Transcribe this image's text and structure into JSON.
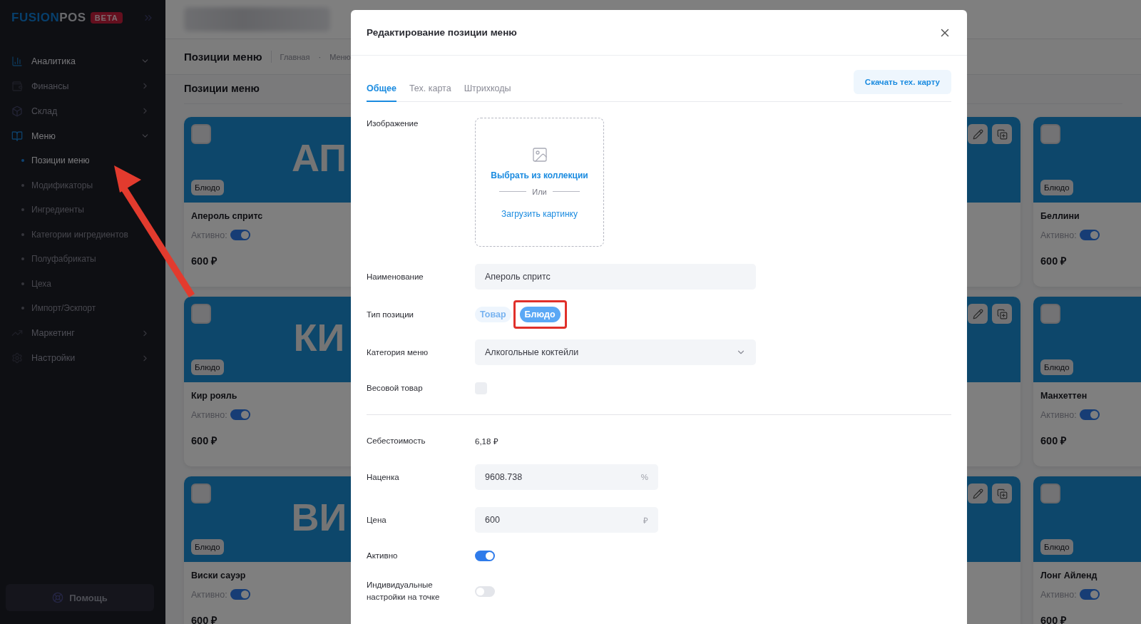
{
  "sidebar": {
    "logo": {
      "part_1": "FUSION",
      "part_2": "POS",
      "badge": "BETA"
    },
    "items": [
      {
        "kind": "analytics",
        "label": "Аналитика",
        "expanded": true
      },
      {
        "kind": "finance",
        "label": "Финансы",
        "expanded": false
      },
      {
        "kind": "warehouse",
        "label": "Склад",
        "expanded": false
      },
      {
        "kind": "menu",
        "label": "Меню",
        "expanded": true,
        "children": [
          {
            "label": "Позиции меню",
            "selected": true
          },
          {
            "label": "Модификаторы",
            "selected": false
          },
          {
            "label": "Ингредиенты",
            "selected": false
          },
          {
            "label": "Категории ингредиентов",
            "selected": false
          },
          {
            "label": "Полуфабрикаты",
            "selected": false
          },
          {
            "label": "Цеха",
            "selected": false
          },
          {
            "label": "Импорт/Эскпорт",
            "selected": false
          }
        ]
      },
      {
        "kind": "marketing",
        "label": "Маркетинг",
        "expanded": false
      },
      {
        "kind": "settings",
        "label": "Настройки",
        "expanded": false
      }
    ],
    "help": "Помощь"
  },
  "header": {
    "page_title": "Позиции меню",
    "breadcrumbs": [
      "Главная",
      "Меню"
    ],
    "breadcrumb_separator": "·",
    "section_title": "Позиции меню"
  },
  "card_rows": [
    {
      "cards": [
        {
          "kind": "full",
          "checked": false,
          "initials": "АП",
          "type": "Блюдо",
          "name": "Апероль спритс",
          "active_label": "Активно:",
          "active": true,
          "price": "600 ₽"
        },
        {
          "kind": "actions"
        },
        {
          "kind": "full",
          "checked": false,
          "type": "Блюдо",
          "name": "Беллини",
          "active_label": "Активно:",
          "active": true,
          "price": "600 ₽"
        }
      ]
    },
    {
      "cards": [
        {
          "kind": "full",
          "checked": false,
          "initials": "КИ",
          "type": "Блюдо",
          "name": "Кир рояль",
          "active_label": "Активно:",
          "active": true,
          "price": "600 ₽"
        },
        {
          "kind": "actions"
        },
        {
          "kind": "full",
          "checked": false,
          "type": "Блюдо",
          "name": "Манхеттен",
          "active_label": "Активно:",
          "active": true,
          "price": "600 ₽"
        }
      ]
    },
    {
      "cards": [
        {
          "kind": "full",
          "checked": false,
          "initials": "ВИ",
          "type": "Блюдо",
          "name": "Виски сауэр",
          "active_label": "Активно:",
          "active": true,
          "price": "600 ₽"
        },
        {
          "kind": "actions"
        },
        {
          "kind": "full",
          "checked": false,
          "type": "Блюдо",
          "name": "Лонг Айленд",
          "active_label": "Активно:",
          "active": true,
          "price": "600 ₽"
        }
      ]
    }
  ],
  "modal": {
    "title": "Редактирование позиции меню",
    "tabs": [
      {
        "label": "Общее",
        "selected": true
      },
      {
        "label": "Тех. карта",
        "selected": false
      },
      {
        "label": "Штрихкоды",
        "selected": false
      }
    ],
    "download_button": "Скачать тех. карту",
    "image": {
      "label": "Изображение",
      "choose": "Выбрать из коллекции",
      "or": "Или",
      "upload": "Загрузить картинку"
    },
    "fields": [
      {
        "kind": "input",
        "label": "Наименование",
        "value": "Апероль спритс"
      },
      {
        "kind": "chips",
        "label": "Тип позиции",
        "options": [
          {
            "label": "Товар",
            "selected": false,
            "highlighted": false
          },
          {
            "label": "Блюдо",
            "selected": true,
            "highlighted": true
          }
        ]
      },
      {
        "kind": "select",
        "label": "Категория меню",
        "value": "Алкогольные коктейли"
      },
      {
        "kind": "checkbox",
        "label": "Весовой товар",
        "checked": false
      },
      {
        "kind": "divider"
      },
      {
        "kind": "text",
        "label": "Себестоимость",
        "value": "6,18 ₽"
      },
      {
        "kind": "suffix_input",
        "label": "Наценка",
        "value": "9608.738",
        "suffix": "%"
      },
      {
        "kind": "suffix_input",
        "label": "Цена",
        "value": "600",
        "suffix": "₽"
      },
      {
        "kind": "toggle",
        "label": "Активно",
        "on": true
      },
      {
        "kind": "toggle",
        "label": "Индивидуальные настройки на точке",
        "on": false
      }
    ]
  }
}
